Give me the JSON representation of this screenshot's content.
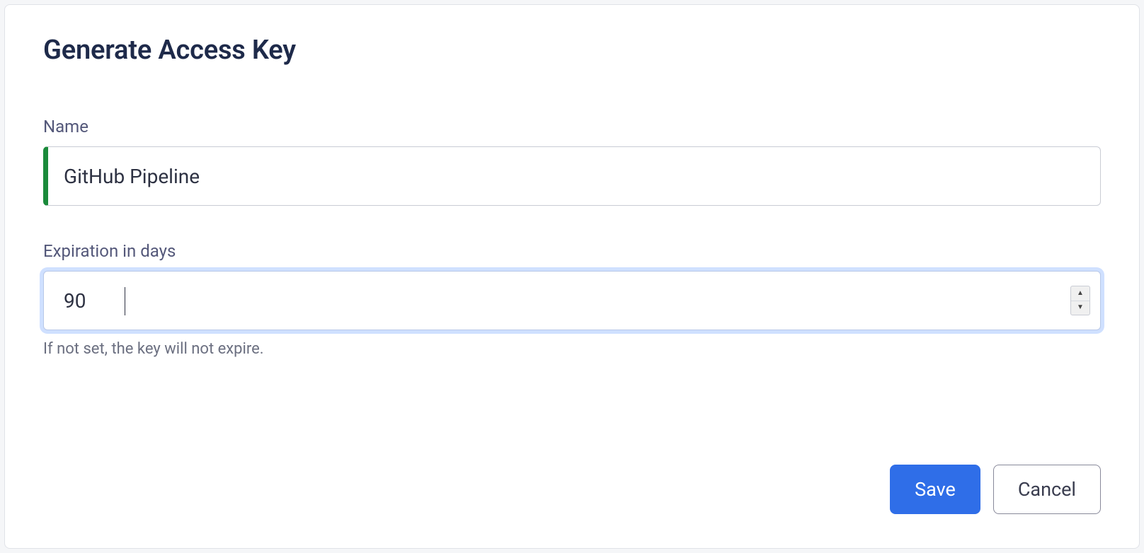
{
  "page_title": "Generate Access Key",
  "fields": {
    "name": {
      "label": "Name",
      "value": "GitHub Pipeline"
    },
    "expiration": {
      "label": "Expiration in days",
      "value": "90",
      "hint": "If not set, the key will not expire."
    }
  },
  "buttons": {
    "save": "Save",
    "cancel": "Cancel"
  }
}
